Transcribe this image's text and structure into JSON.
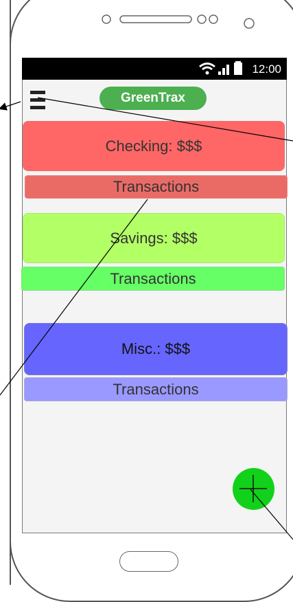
{
  "app": {
    "title": "GreenTrax"
  },
  "status_bar": {
    "time": "12:00"
  },
  "accounts": [
    {
      "balance_label": "Checking: $$$",
      "transactions_label": "Transactions"
    },
    {
      "balance_label": "Savings: $$$",
      "transactions_label": "Transactions"
    },
    {
      "balance_label": "Misc.: $$$",
      "transactions_label": "Transactions"
    }
  ],
  "icons": {
    "menu": "hamburger-menu-icon",
    "add": "plus-icon",
    "wifi": "wifi-icon",
    "signal": "signal-icon",
    "battery": "battery-icon"
  },
  "colors": {
    "title_pill": "#4caf50",
    "checking": "#ff6666",
    "checking_tx": "#ea6b66",
    "savings": "#b3ff66",
    "savings_tx": "#66ff66",
    "misc": "#6666ff",
    "misc_tx": "#9999ff",
    "fab": "#12d11a"
  }
}
